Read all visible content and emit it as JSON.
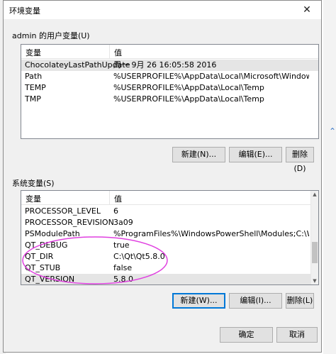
{
  "dialog": {
    "title": "环境变量",
    "close_glyph": "✕"
  },
  "user_vars": {
    "group_label": "admin 的用户变量(U)",
    "headers": [
      "变量",
      "值"
    ],
    "rows": [
      [
        "ChocolateyLastPathUpdate",
        "周一 9月 26 16:05:58 2016"
      ],
      [
        "Path",
        "%USERPROFILE%\\AppData\\Local\\Microsoft\\WindowsApps;C:..."
      ],
      [
        "TEMP",
        "%USERPROFILE%\\AppData\\Local\\Temp"
      ],
      [
        "TMP",
        "%USERPROFILE%\\AppData\\Local\\Temp"
      ]
    ],
    "buttons": {
      "new": "新建(N)...",
      "edit": "编辑(E)...",
      "delete": "删除(D)"
    }
  },
  "system_vars": {
    "group_label": "系统变量(S)",
    "headers": [
      "变量",
      "值"
    ],
    "rows": [
      [
        "PROCESSOR_LEVEL",
        "6"
      ],
      [
        "PROCESSOR_REVISION",
        "3a09"
      ],
      [
        "PSModulePath",
        "%ProgramFiles%\\WindowsPowerShell\\Modules;C:\\Windows\\..."
      ],
      [
        "QT_DEBUG",
        "true"
      ],
      [
        "QT_DIR",
        "C:\\Qt\\Qt5.8.0"
      ],
      [
        "QT_STUB",
        "false"
      ],
      [
        "QT_VERSION",
        "5.8.0"
      ]
    ],
    "buttons": {
      "new": "新建(W)...",
      "edit": "编辑(I)...",
      "delete": "删除(L)"
    }
  },
  "footer": {
    "ok": "确定",
    "cancel": "取消"
  },
  "annotation": {
    "color": "#e040e0"
  },
  "colors": {
    "focus_border": "#0078d7",
    "button_bg": "#e1e1e1",
    "dialog_bg": "#f0f0f0"
  }
}
